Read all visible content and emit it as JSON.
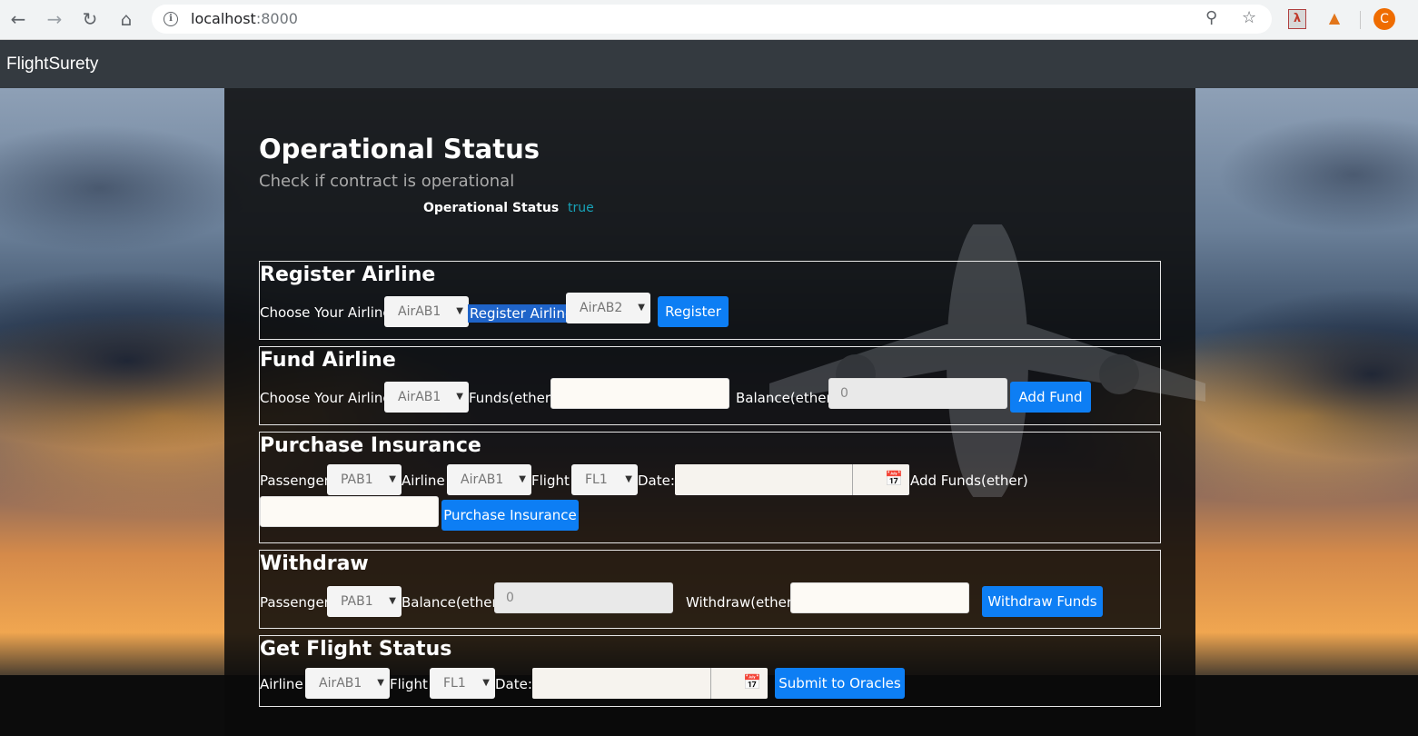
{
  "browser": {
    "url_host": "localhost",
    "url_port": ":8000",
    "avatar_letter": "C"
  },
  "navbar": {
    "brand": "FlightSurety"
  },
  "operational": {
    "title": "Operational Status",
    "subtitle": "Check if contract is operational",
    "status_label": "Operational Status",
    "status_value": "true"
  },
  "register": {
    "title": "Register Airline",
    "choose_label": "Choose Your Airline",
    "choose_value": "AirAB1",
    "highlight_label": "Register Airline",
    "new_airline_value": "AirAB2",
    "button": "Register"
  },
  "fund": {
    "title": "Fund Airline",
    "choose_label": "Choose Your Airline",
    "choose_value": "AirAB1",
    "funds_label": "Funds(ether)",
    "funds_value": "",
    "balance_label": "Balance(ether)",
    "balance_value": "0",
    "button": "Add Fund"
  },
  "purchase": {
    "title": "Purchase Insurance",
    "passenger_label": "Passenger",
    "passenger_value": "PAB1",
    "airline_label": "Airline",
    "airline_value": "AirAB1",
    "flight_label": "Flight",
    "flight_value": "FL1",
    "date_label": "Date:",
    "add_funds_label": "Add Funds(ether)",
    "button": "Purchase Insurance"
  },
  "withdraw": {
    "title": "Withdraw",
    "passenger_label": "Passenger",
    "passenger_value": "PAB1",
    "balance_label": "Balance(ether)",
    "balance_value": "0",
    "withdraw_label": "Withdraw(ether)",
    "button": "Withdraw Funds"
  },
  "flight_status": {
    "title": "Get Flight Status",
    "airline_label": "Airline",
    "airline_value": "AirAB1",
    "flight_label": "Flight",
    "flight_value": "FL1",
    "date_label": "Date:",
    "button": "Submit to Oracles"
  }
}
